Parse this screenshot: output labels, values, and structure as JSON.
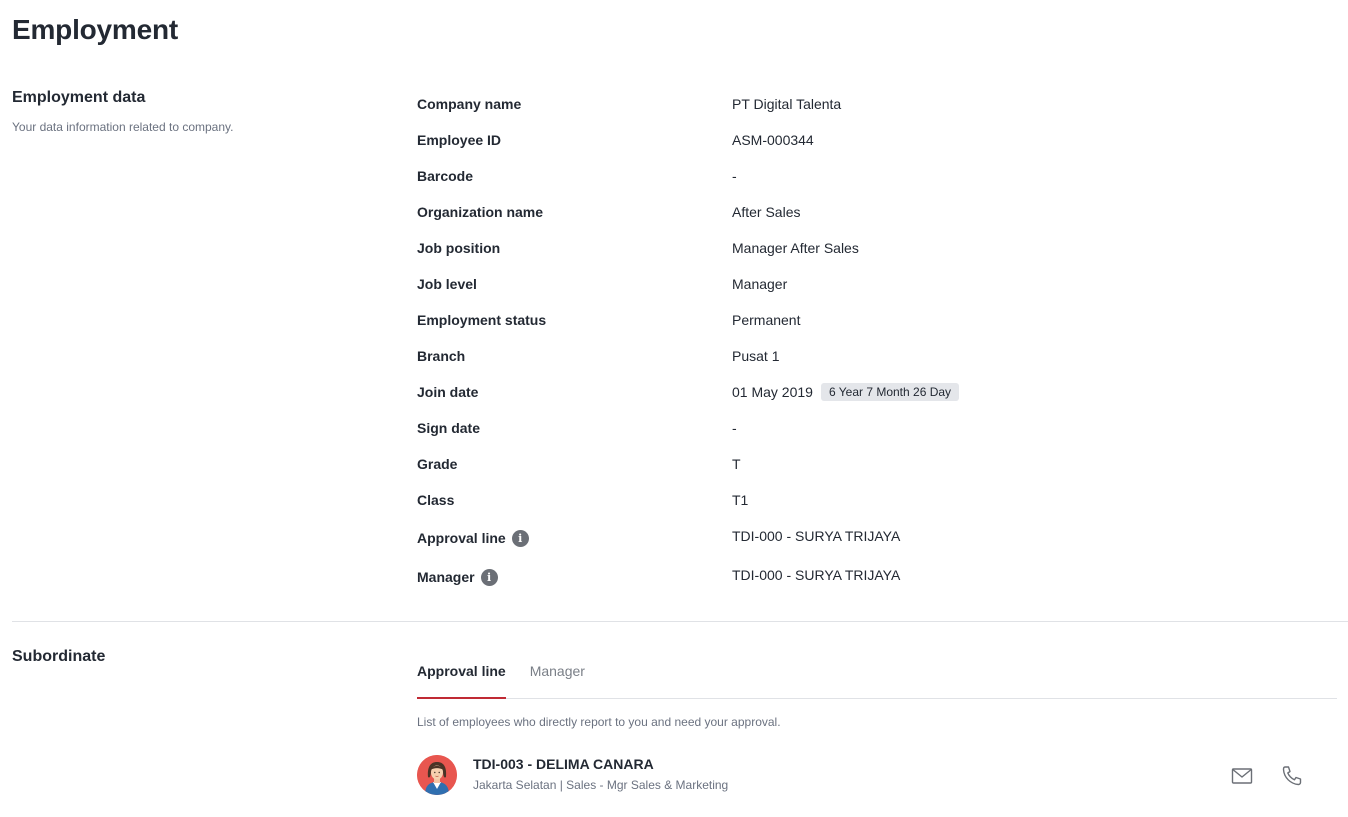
{
  "page": {
    "title": "Employment"
  },
  "employment": {
    "title": "Employment data",
    "description": "Your data information related to company.",
    "fields": [
      {
        "label": "Company name",
        "value": "PT Digital Talenta"
      },
      {
        "label": "Employee ID",
        "value": "ASM-000344"
      },
      {
        "label": "Barcode",
        "value": "-"
      },
      {
        "label": "Organization name",
        "value": "After Sales"
      },
      {
        "label": "Job position",
        "value": "Manager After Sales"
      },
      {
        "label": "Job level",
        "value": "Manager"
      },
      {
        "label": "Employment status",
        "value": "Permanent"
      },
      {
        "label": "Branch",
        "value": "Pusat 1"
      },
      {
        "label": "Join date",
        "value": "01 May 2019",
        "badge": "6 Year 7 Month 26 Day"
      },
      {
        "label": "Sign date",
        "value": "-"
      },
      {
        "label": "Grade",
        "value": "T"
      },
      {
        "label": "Class",
        "value": "T1"
      },
      {
        "label": "Approval line",
        "value": "TDI-000 - SURYA TRIJAYA",
        "icon": "info-icon"
      },
      {
        "label": "Manager",
        "value": "TDI-000 - SURYA TRIJAYA",
        "icon": "info-icon"
      }
    ]
  },
  "subordinate": {
    "title": "Subordinate",
    "tabs": [
      {
        "label": "Approval line",
        "active": true
      },
      {
        "label": "Manager",
        "active": false
      }
    ],
    "description": "List of employees who directly report to you and need your approval.",
    "employees": [
      {
        "name": "TDI-003 - DELIMA CANARA",
        "meta": "Jakarta Selatan | Sales - Mgr Sales & Marketing",
        "avatar": "avatar-female-icon",
        "actions": [
          "mail-icon",
          "phone-icon"
        ]
      }
    ]
  },
  "colors": {
    "accent": "#c02a34",
    "text": "#232933",
    "muted": "#6b7280",
    "badge_bg": "#e4e6ea",
    "avatar_bg": "#e8564f"
  }
}
